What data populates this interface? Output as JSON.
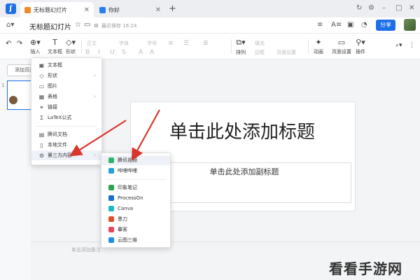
{
  "tabs": {
    "active": {
      "label": "无标题幻灯片"
    },
    "inactive": {
      "label": "你好"
    },
    "new_tab": "+"
  },
  "window_controls": [
    "↻",
    "⚙",
    "–",
    "□",
    "✕"
  ],
  "header": {
    "doc_title": "无标题幻灯片",
    "saved_text": "最近保存 16:24",
    "share_label": "分享"
  },
  "toolbar": {
    "undo": "↶",
    "redo": "↷",
    "insert": "插入",
    "textbox": "文本框",
    "shape": "形状",
    "style": "正文",
    "font": "字体",
    "size": "字号",
    "arrange": "排列",
    "fill": "填充",
    "border": "边框",
    "slide_settings": "页面设置",
    "animation": "动画",
    "page_setup": "页面设置",
    "plugins": "插件"
  },
  "left_panel": {
    "add_slide": "添加页面",
    "slide_number": "1"
  },
  "slide": {
    "title_placeholder": "单击此处添加标题",
    "subtitle_placeholder": "单击此处添加副标题"
  },
  "notes_placeholder": "单击添加备注",
  "insert_menu": {
    "items": [
      {
        "icon": "▣",
        "label": "文本框"
      },
      {
        "icon": "◇",
        "label": "形状",
        "submenu": true
      },
      {
        "icon": "▭",
        "label": "图片"
      },
      {
        "icon": "▦",
        "label": "表格",
        "submenu": true
      },
      {
        "icon": "⚭",
        "label": "链接"
      },
      {
        "icon": "Σ",
        "label": "LaTeX公式"
      },
      {
        "icon": "▤",
        "label": "腾讯文档"
      },
      {
        "icon": "▯",
        "label": "本地文件"
      },
      {
        "icon": "⚙",
        "label": "第三方内容",
        "submenu": true
      }
    ]
  },
  "third_party_menu": {
    "items": [
      {
        "label": "腾讯视频",
        "color": "#2fb36b"
      },
      {
        "label": "哔哩哔哩",
        "color": "#21a1de"
      },
      {
        "label": "印象笔记",
        "color": "#2ca24f"
      },
      {
        "label": "ProcessOn",
        "color": "#1a6fd1"
      },
      {
        "label": "Canva",
        "color": "#20b8c7"
      },
      {
        "label": "墨刀",
        "color": "#e04f2a"
      },
      {
        "label": "摹客",
        "color": "#e8465a"
      },
      {
        "label": "云图三维",
        "color": "#1d8fe8"
      }
    ]
  },
  "watermark": "看看手游网",
  "colors": {
    "accent": "#1d6fe8",
    "arrow": "#d9362b"
  }
}
